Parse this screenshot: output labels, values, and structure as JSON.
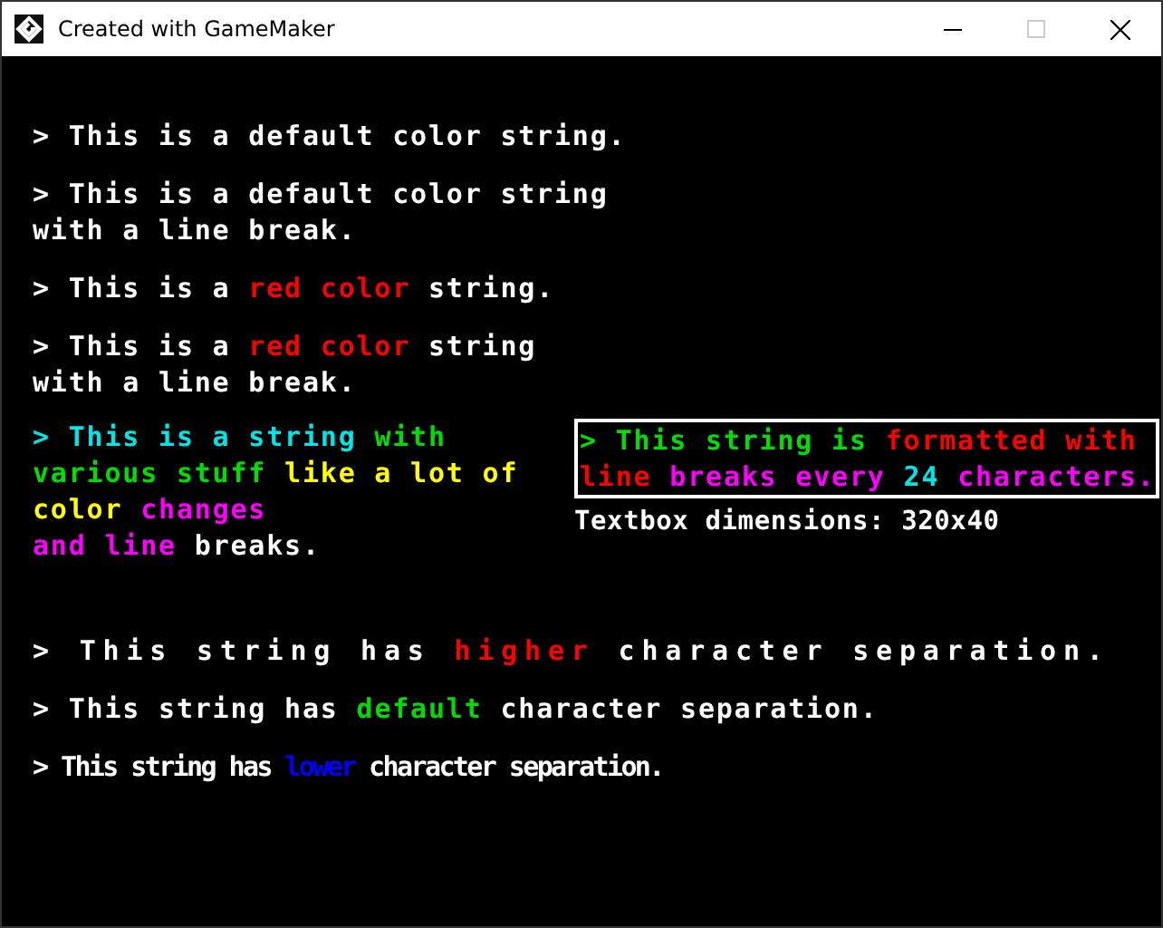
{
  "window": {
    "title": "Created with GameMaker",
    "maximize_disabled": true
  },
  "strings_top": [
    {
      "kind": "normal",
      "lines": [
        [
          {
            "text": "> This is a default color string.",
            "color": "#ffffff"
          }
        ]
      ]
    },
    {
      "kind": "normal",
      "lines": [
        [
          {
            "text": "> This is a default color string",
            "color": "#ffffff"
          }
        ],
        [
          {
            "text": "with a line break.",
            "color": "#ffffff"
          }
        ]
      ]
    },
    {
      "kind": "normal",
      "lines": [
        [
          {
            "text": "> This is a ",
            "color": "#ffffff"
          },
          {
            "text": "red color",
            "color": "#ff0000"
          },
          {
            "text": " string.",
            "color": "#ffffff"
          }
        ]
      ]
    },
    {
      "kind": "normal",
      "lines": [
        [
          {
            "text": "> This is a ",
            "color": "#ffffff"
          },
          {
            "text": "red color",
            "color": "#ff0000"
          },
          {
            "text": " string",
            "color": "#ffffff"
          }
        ],
        [
          {
            "text": "with a line break.",
            "color": "#ffffff"
          }
        ]
      ]
    }
  ],
  "multicolor": {
    "kind": "normal",
    "lines": [
      [
        {
          "text": "> This is a string ",
          "color": "#00e5e5"
        },
        {
          "text": "with",
          "color": "#00dd00"
        }
      ],
      [
        {
          "text": "various stuff ",
          "color": "#00dd00"
        },
        {
          "text": "like a lot of",
          "color": "#ffff00"
        }
      ],
      [
        {
          "text": "color ",
          "color": "#ffff00"
        },
        {
          "text": "changes",
          "color": "#ff00ff"
        }
      ],
      [
        {
          "text": "and line ",
          "color": "#ff00ff"
        },
        {
          "text": "breaks.",
          "color": "#ffffff"
        }
      ]
    ]
  },
  "textbox": {
    "lines": [
      [
        {
          "text": "> This string is ",
          "color": "#00dd00"
        },
        {
          "text": "formatted with",
          "color": "#ff0000"
        }
      ],
      [
        {
          "text": "line ",
          "color": "#ff0000"
        },
        {
          "text": "breaks every ",
          "color": "#ff00ff"
        },
        {
          "text": "24",
          "color": "#00e5e5"
        },
        {
          "text": " characters.",
          "color": "#ff00ff"
        }
      ]
    ],
    "caption": "Textbox dimensions: 320x40"
  },
  "strings_bottom": [
    {
      "kind": "wide",
      "lines": [
        [
          {
            "text": "> This string has ",
            "color": "#ffffff"
          },
          {
            "text": "higher",
            "color": "#ff0000"
          },
          {
            "text": " character separation.",
            "color": "#ffffff"
          }
        ]
      ]
    },
    {
      "kind": "normal",
      "lines": [
        [
          {
            "text": "> This string has ",
            "color": "#ffffff"
          },
          {
            "text": "default",
            "color": "#00dd00"
          },
          {
            "text": " character separation.",
            "color": "#ffffff"
          }
        ]
      ]
    },
    {
      "kind": "tight",
      "lines": [
        [
          {
            "text": "> This string has ",
            "color": "#ffffff"
          },
          {
            "text": "lower",
            "color": "#0000ff"
          },
          {
            "text": " character separation.",
            "color": "#ffffff"
          }
        ]
      ]
    }
  ]
}
